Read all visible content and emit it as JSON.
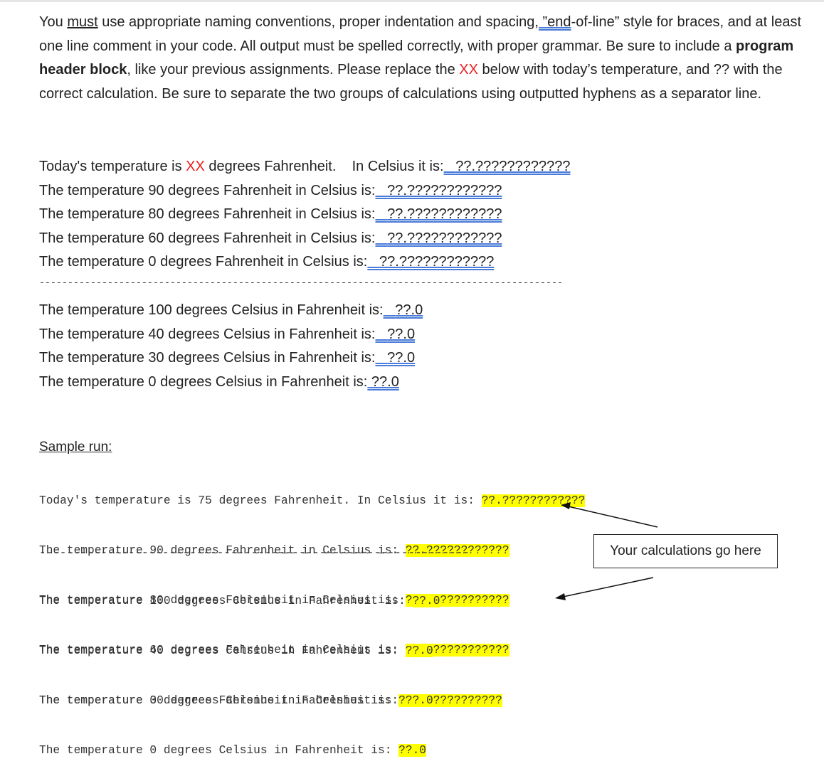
{
  "instructions": {
    "s1": "You ",
    "must": "must",
    "s2": " use appropriate naming conventions, proper indentation and spacing",
    "s3": ", ”end",
    "s4": "-of-line” style for braces, and at least one line comment in your code.   All output must be spelled correctly, with proper grammar.   Be sure to include a ",
    "bold": "program header block",
    "s5": ", like your previous assignments.   Please replace the ",
    "xx": "XX",
    "s6": " below with today’s temperature, and ?? with the correct calculation.   Be sure to separate the two groups of calculations using outputted hyphens as a separator line."
  },
  "output_lines": {
    "line1_a": "Today's temperature is ",
    "line1_xx": "XX",
    "line1_b": " degrees Fahrenheit.    In Celsius it is:",
    "line1_val": "??.????????????",
    "f_lines": [
      {
        "text": "The temperature 90 degrees Fahrenheit in Celsius is:",
        "val": "??.????????????"
      },
      {
        "text": "The temperature 80 degrees Fahrenheit in Celsius is:",
        "val": "??.????????????"
      },
      {
        "text": "The temperature 60 degrees Fahrenheit in Celsius is:",
        "val": "??.????????????"
      },
      {
        "text": "The temperature 0 degrees Fahrenheit in Celsius is:",
        "val": "??.????????????"
      }
    ],
    "separator": "--------------------------------------------------------------------------------------------",
    "c_lines": [
      {
        "text": "The temperature 100 degrees Celsius in Fahrenheit is:",
        "val": "??.0"
      },
      {
        "text": "The temperature 40 degrees Celsius in Fahrenheit is:",
        "val": "??.0"
      },
      {
        "text": "The temperature 30 degrees Celsius in Fahrenheit is:",
        "val": "??.0"
      },
      {
        "text": "The temperature 0 degrees Celsius in Fahrenheit is:",
        "val": "??.0"
      }
    ]
  },
  "sample": {
    "heading": "Sample run:",
    "lines": [
      {
        "text": "Today's temperature is 75 degrees Fahrenheit. In Celsius it is: ",
        "val": "??.????????????"
      },
      {
        "text": "The temperature 90 degrees Fahrenheit in Celsius is: ",
        "val": "??.????????????"
      },
      {
        "text": "The temperature 80 degrees Fahrenheit in Celsius is: ",
        "val": "??.????????????"
      },
      {
        "text": "The temperature 60 degrees Fahrenheit in Celsius is: ",
        "val": "??.????????????"
      },
      {
        "text": "The temperature 0 degrees Fahrenheit in Celsius is: ",
        "val": "??.????????????"
      }
    ],
    "separator": "---------------------------------------------------------------",
    "lines2": [
      {
        "text": "The temperature 100 degrees Celsius in Fahrenheit is: ",
        "val": "??.0"
      },
      {
        "text": "The temperature 40 degrees Celsius in Fahrenheit is: ",
        "val": "??.0"
      },
      {
        "text": "The temperature 30 degrees Celsius in Fahrenheit is: ",
        "val": "??.0"
      },
      {
        "text": "The temperature 0 degrees Celsius in Fahrenheit is: ",
        "val": "??.0"
      }
    ]
  },
  "callout": {
    "label": "Your calculations go here"
  },
  "colors": {
    "highlight": "#ffff00",
    "red": "#ee1c1c",
    "underline": "#4a7bd8"
  }
}
